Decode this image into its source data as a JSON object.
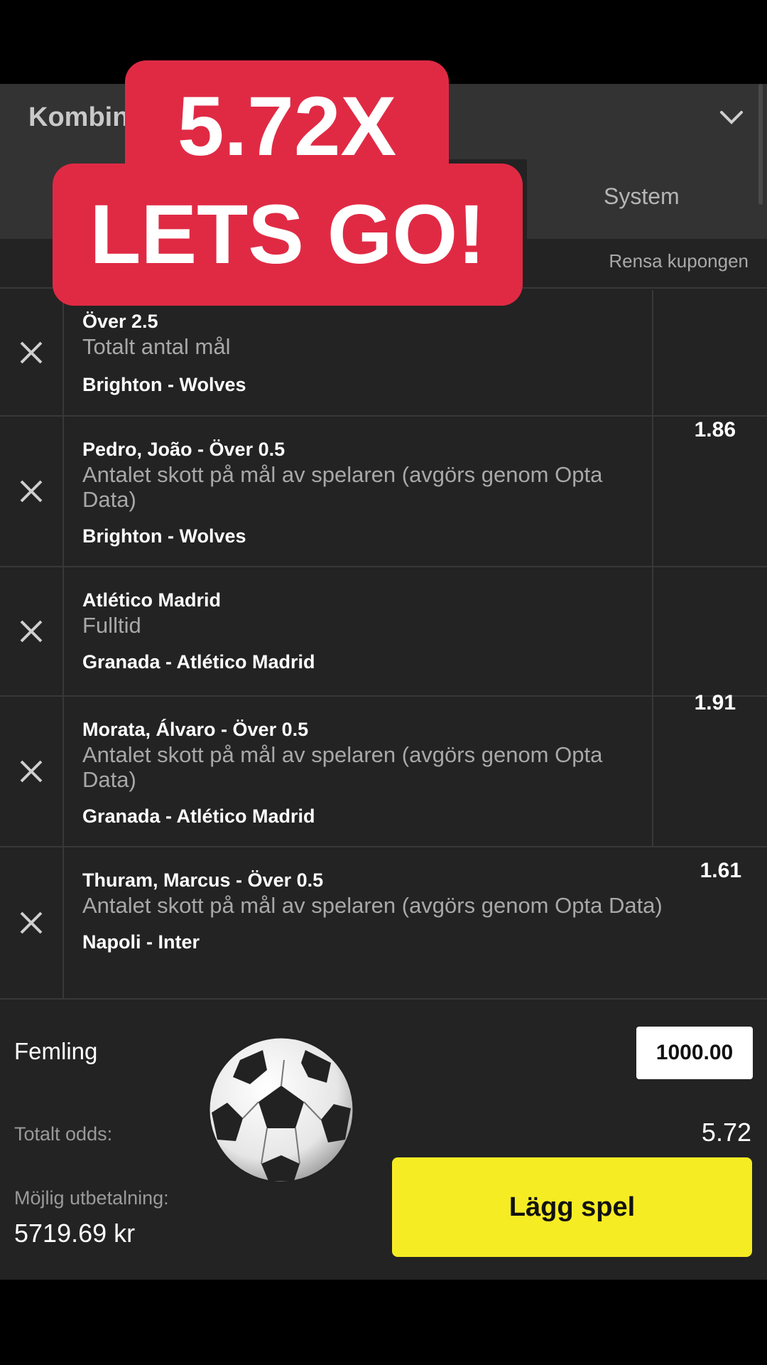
{
  "header": {
    "title": "Kombin"
  },
  "tabs": {
    "system": "System"
  },
  "coupon": {
    "clear_label": "Rensa kupongen"
  },
  "groups": [
    {
      "odds": "1.86",
      "selections": [
        {
          "title": "Över 2.5",
          "market": "Totalt antal mål",
          "match": "Brighton - Wolves"
        },
        {
          "title": "Pedro, João - Över 0.5",
          "market": "Antalet skott på mål av spelaren (avgörs genom Opta Data)",
          "match": "Brighton - Wolves"
        }
      ]
    },
    {
      "odds": "1.91",
      "selections": [
        {
          "title": "Atlético Madrid",
          "market": "Fulltid",
          "match": "Granada - Atlético Madrid"
        },
        {
          "title": "Morata, Álvaro - Över 0.5",
          "market": "Antalet skott på mål av spelaren (avgörs genom Opta Data)",
          "match": "Granada - Atlético Madrid"
        }
      ]
    },
    {
      "odds": "1.61",
      "selections": [
        {
          "title": "Thuram, Marcus - Över 0.5",
          "market": "Antalet skott på mål av spelaren (avgörs genom Opta Data)",
          "match": "Napoli - Inter"
        }
      ]
    }
  ],
  "footer": {
    "bet_type": "Femling",
    "stake": "1000.00",
    "total_odds_label": "Totalt odds:",
    "total_odds": "5.72",
    "payout_label": "Möjlig utbetalning:",
    "payout": "5719.69 kr",
    "place_bet": "Lägg spel"
  },
  "overlay": {
    "line1": "5.72X",
    "line2": "LETS GO!"
  },
  "icons": {
    "remove": "close-icon",
    "chevron": "chevron-down-icon",
    "ball": "soccer-ball-icon"
  },
  "colors": {
    "accent": "#f6ec23",
    "overlay": "#e02a44",
    "background": "#232323"
  }
}
